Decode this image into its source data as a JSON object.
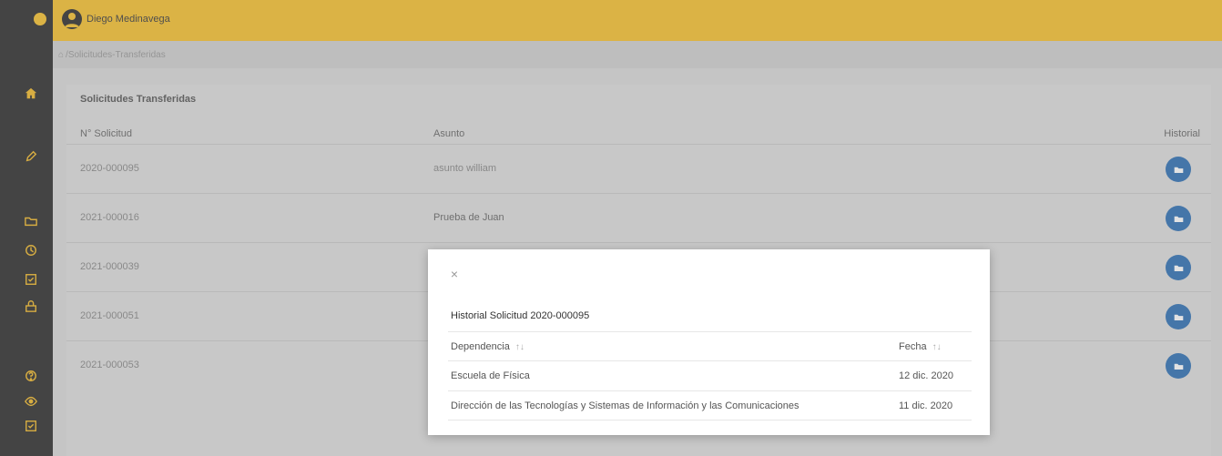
{
  "header": {
    "user_name": "Diego Medinavega"
  },
  "breadcrumb": {
    "path": "/Solicitudes-Transferidas"
  },
  "card": {
    "title": "Solicitudes Transferidas",
    "columns": [
      "N° Solicitud",
      "Asunto",
      "Historial"
    ],
    "rows": [
      {
        "id": "2020-000095",
        "asunto": "asunto william"
      },
      {
        "id": "2021-000016",
        "asunto": "Prueba de Juan"
      },
      {
        "id": "2021-000039",
        "asunto": ""
      },
      {
        "id": "2021-000051",
        "asunto": ""
      },
      {
        "id": "2021-000053",
        "asunto": ""
      }
    ]
  },
  "sidebar": {
    "icons": [
      "home-icon",
      "pencil-icon",
      "folder-icon",
      "clock-icon",
      "checkbox-icon",
      "lock-icon",
      "help-icon",
      "eye-icon",
      "checkbox-icon"
    ]
  },
  "modal": {
    "close_label": "×",
    "title": "Historial Solicitud 2020-000095",
    "columns": [
      "Dependencia",
      "Fecha"
    ],
    "sort_symbol": "↑↓",
    "rows": [
      {
        "dependencia": "Escuela de Física",
        "fecha": "12 dic. 2020"
      },
      {
        "dependencia": "Dirección de las Tecnologías y Sistemas de Información y las Comunicaciones",
        "fecha": "11 dic. 2020"
      }
    ]
  },
  "colors": {
    "accent": "#f6c02e",
    "sidebar": "#2d2d2d",
    "button": "#2e6fb3"
  }
}
